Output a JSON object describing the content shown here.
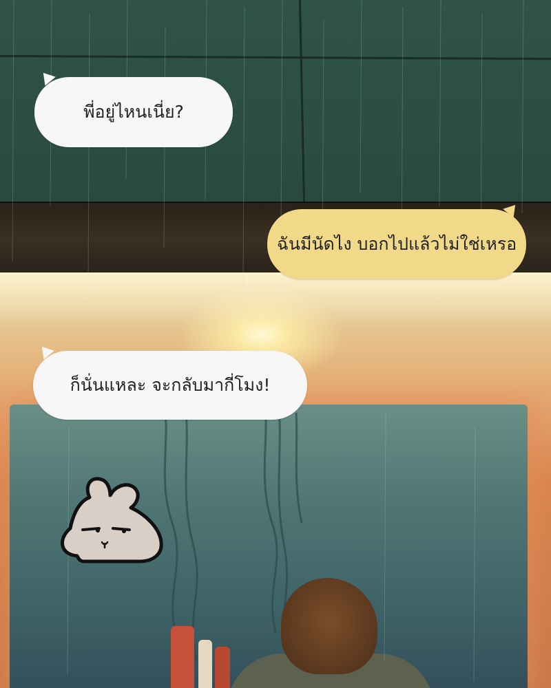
{
  "panel": {
    "bubbles": [
      {
        "text": "พี่อยู่ไหนเนี่ย?",
        "style": "white"
      },
      {
        "text": "ฉันมีนัดไง บอกไปแล้วไม่ใช่เหรอ",
        "style": "yellow"
      },
      {
        "text": "ก็นั่นแหละ จะกลับมากี่โมง!",
        "style": "white"
      }
    ],
    "colors": {
      "wall": "#2f5346",
      "ledge": "#3a3022",
      "window_glow": "#e3a06a",
      "inner_pane": "#4f7674",
      "bubble_white": "#f7f7f5",
      "bubble_yellow": "#f2d98a"
    },
    "sticker_icon": "grumpy-bunny-icon"
  }
}
